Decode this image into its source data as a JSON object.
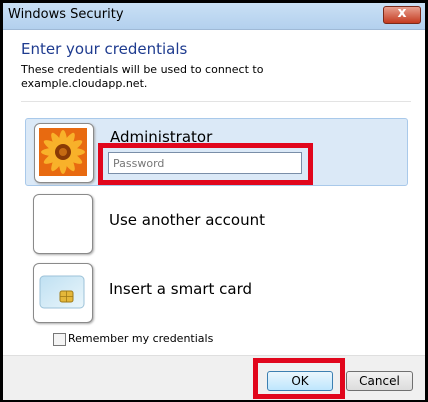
{
  "window": {
    "title": "Windows Security",
    "close_glyph": "x"
  },
  "dialog": {
    "heading": "Enter your credentials",
    "description_line1": "These credentials will be used to connect to",
    "description_line2": "example.cloudapp.net."
  },
  "accounts": [
    {
      "label": "Administrator",
      "icon": "flower-user-tile-icon",
      "selected": true
    },
    {
      "label": "Use another account",
      "icon": "blank-user-tile-icon",
      "selected": false
    },
    {
      "label": "Insert a smart card",
      "icon": "smart-card-icon",
      "selected": false
    }
  ],
  "password": {
    "placeholder": "Password",
    "value": ""
  },
  "remember": {
    "label": "Remember my credentials",
    "checked": false
  },
  "buttons": {
    "ok": "OK",
    "cancel": "Cancel"
  },
  "colors": {
    "heading": "#1e3b8f",
    "highlight": "#e1061c",
    "selected_tile": "#dbe9f7"
  }
}
